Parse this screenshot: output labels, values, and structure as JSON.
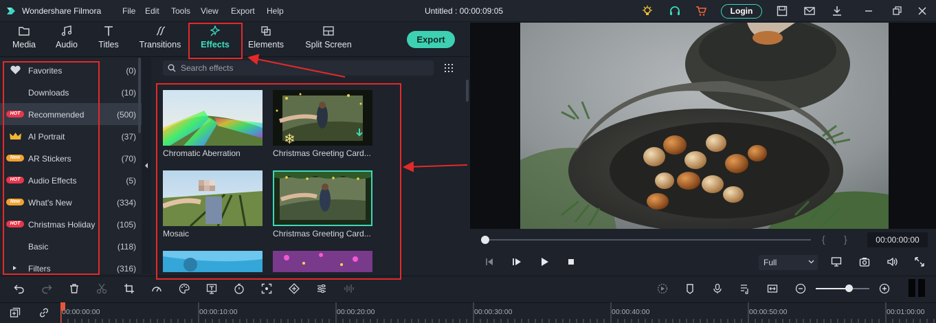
{
  "app": {
    "name": "Wondershare Filmora",
    "document_title": "Untitled : 00:00:09:05"
  },
  "menu": [
    "File",
    "Edit",
    "Tools",
    "View",
    "Export",
    "Help"
  ],
  "header": {
    "login_label": "Login"
  },
  "tabs": [
    {
      "label": "Media",
      "icon": "folder-icon"
    },
    {
      "label": "Audio",
      "icon": "music-note-icon"
    },
    {
      "label": "Titles",
      "icon": "text-t-icon"
    },
    {
      "label": "Transitions",
      "icon": "transition-icon"
    },
    {
      "label": "Effects",
      "icon": "effects-sparkle-icon",
      "active": true
    },
    {
      "label": "Elements",
      "icon": "elements-icon"
    },
    {
      "label": "Split Screen",
      "icon": "split-screen-icon"
    }
  ],
  "export_label": "Export",
  "sidebar": {
    "categories": [
      {
        "label": "Favorites",
        "count": "(0)",
        "icon": "heart-icon"
      },
      {
        "label": "Downloads",
        "count": "(10)"
      },
      {
        "label": "Recommended",
        "count": "(500)",
        "badge": "HOT",
        "selected": true
      },
      {
        "label": "AI Portrait",
        "count": "(37)",
        "icon": "crown-icon"
      },
      {
        "label": "AR Stickers",
        "count": "(70)",
        "badge": "New"
      },
      {
        "label": "Audio Effects",
        "count": "(5)",
        "badge": "HOT"
      },
      {
        "label": "What's New",
        "count": "(334)",
        "badge": "New"
      },
      {
        "label": "Christmas Holiday",
        "count": "(105)",
        "badge": "HOT"
      },
      {
        "label": "Basic",
        "count": "(118)"
      },
      {
        "label": "Filters",
        "count": "(316)",
        "icon": "expand-arrow-icon"
      }
    ]
  },
  "search": {
    "placeholder": "Search effects"
  },
  "effects": [
    {
      "name": "Chromatic Aberration"
    },
    {
      "name": "Christmas Greeting Card..."
    },
    {
      "name": "Mosaic"
    },
    {
      "name": "Christmas Greeting Card..."
    }
  ],
  "preview": {
    "timecode": "00:00:00:00",
    "quality": "Full",
    "progress": 0.0
  },
  "timeline": {
    "labels": [
      "00:00:00:00",
      "00:00:10:00",
      "00:00:20:00",
      "00:00:30:00",
      "00:00:40:00",
      "00:00:50:00",
      "00:01:00:00"
    ],
    "zoom_level": 0.62
  },
  "colors": {
    "accent": "#3ed8b8",
    "annotation": "#e52929",
    "hot_badge": "#e6374b",
    "new_badge": "#f0a231"
  }
}
